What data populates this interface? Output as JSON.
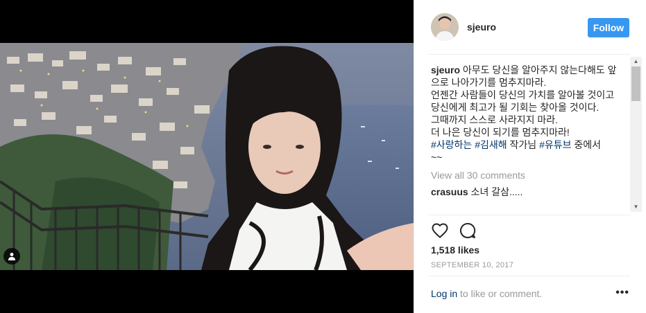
{
  "post": {
    "username": "sjeuro",
    "follow_label": "Follow",
    "caption": {
      "user": "sjeuro",
      "lines": [
        " 아무도 당신을 알아주지 않는다해도 앞으로 나아가기를 멈추지마라.",
        "언젠간 사람들이 당신의 가치를 알아볼 것이고 당신에게 최고가 될 기회는 찾아올 것이다.",
        "그때까지 스스로 사라지지 마라.",
        "더 나은 당신이 되기를 멈추지마라!"
      ],
      "hashtag1": "#사랑하는",
      "hashtag2": "#김새해",
      "middle_text": " 작가님 ",
      "hashtag3": "#유튜브",
      "end_text": " 중에서",
      "tail": "~~"
    },
    "view_all_comments": "View all 30 comments",
    "comments": [
      {
        "user": "crasuus",
        "text": " 소녀 갈삼....."
      }
    ],
    "likes": "1,518 likes",
    "date": "SEPTEMBER 10, 2017",
    "login_link": "Log in",
    "login_suffix": " to like or comment.",
    "more_glyph": "•••"
  },
  "icons": {
    "like": "heart-icon",
    "comment": "comment-icon",
    "user_tag": "user-icon",
    "more": "more-icon"
  },
  "colors": {
    "accent": "#3897f0",
    "link": "#003569",
    "muted": "#999999",
    "text": "#262626"
  }
}
